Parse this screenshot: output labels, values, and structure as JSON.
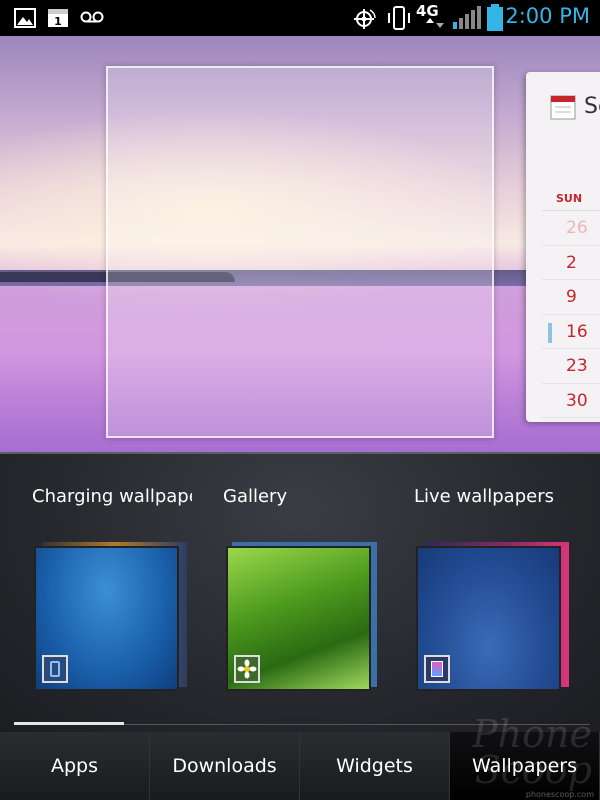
{
  "status_bar": {
    "time": "2:00 PM",
    "network": "4G",
    "colors": {
      "accent": "#33b5e5"
    },
    "icons": [
      "image-notification-icon",
      "calendar-notification-icon",
      "voicemail-icon",
      "gps-icon",
      "vibrate-icon",
      "4g-data-icon",
      "signal-icon",
      "battery-icon"
    ]
  },
  "calendar_widget": {
    "title": "Se",
    "day_header": "SUN",
    "days": [
      "26",
      "2",
      "9",
      "16",
      "23",
      "30"
    ]
  },
  "picker": {
    "options": [
      {
        "label": "Charging wallpaper"
      },
      {
        "label": "Gallery"
      },
      {
        "label": "Live wallpapers"
      }
    ]
  },
  "tabs": [
    {
      "label": "Apps",
      "active": false
    },
    {
      "label": "Downloads",
      "active": false
    },
    {
      "label": "Widgets",
      "active": false
    },
    {
      "label": "Wallpapers",
      "active": true
    }
  ],
  "watermark": {
    "text_line1": "Phone",
    "text_line2": "Scoop",
    "url": "phonescoop.com"
  }
}
